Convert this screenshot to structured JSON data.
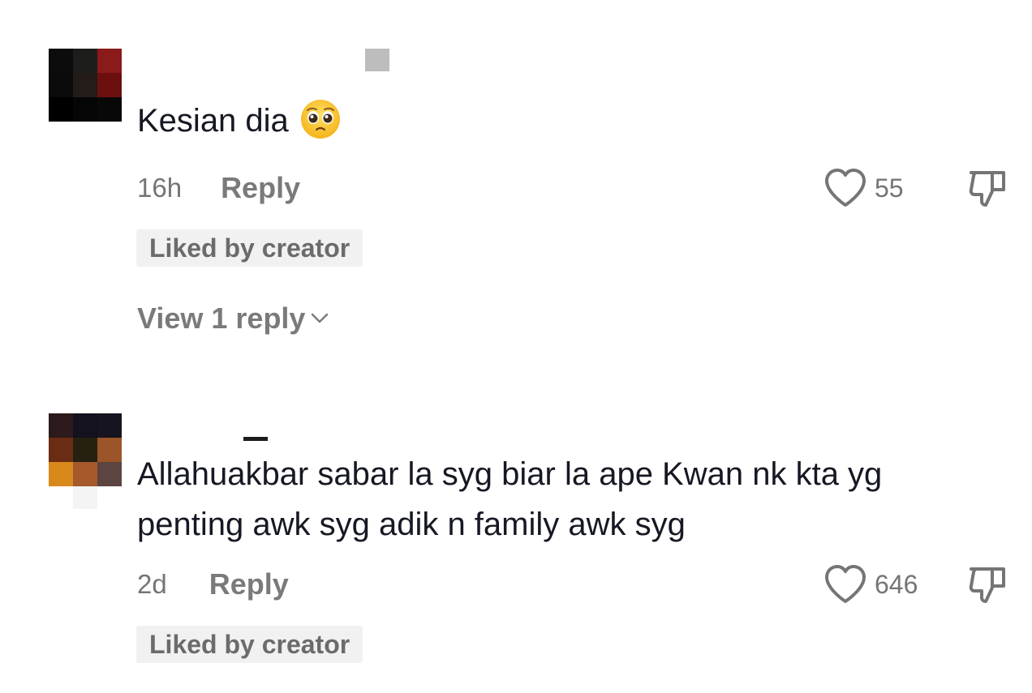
{
  "comments": [
    {
      "text": "Kesian dia",
      "emoji": "pleading-face-emoji",
      "time": "16h",
      "reply_label": "Reply",
      "likes": "55",
      "badge": "Liked by creator",
      "view_replies": "View 1 reply",
      "avatar_colors": [
        "#0c0c0c",
        "#1d1e1c",
        "#8b1a1a",
        "#0a0a0a",
        "#241c18",
        "#6b0f0f",
        "#000000",
        "#050505",
        "#080808"
      ]
    },
    {
      "text_line1": "Allahuakbar sabar la syg biar la ape Kwan nk kta yg",
      "text_line2": "penting awk syg adik n family awk syg",
      "time": "2d",
      "reply_label": "Reply",
      "likes": "646",
      "badge": "Liked by creator",
      "avatar_colors": [
        "#2c1a1c",
        "#14121e",
        "#16141f",
        "#6a2d14",
        "#262011",
        "#9b5528",
        "#d9891c",
        "#a65a2c",
        "#5c4440"
      ]
    }
  ],
  "icons": {
    "like": "heart-outline-icon",
    "dislike": "thumbs-down-icon",
    "expand": "chevron-down-icon"
  },
  "colors": {
    "text": "#161823",
    "muted": "#757575",
    "badge_bg": "#f1f1f2"
  }
}
